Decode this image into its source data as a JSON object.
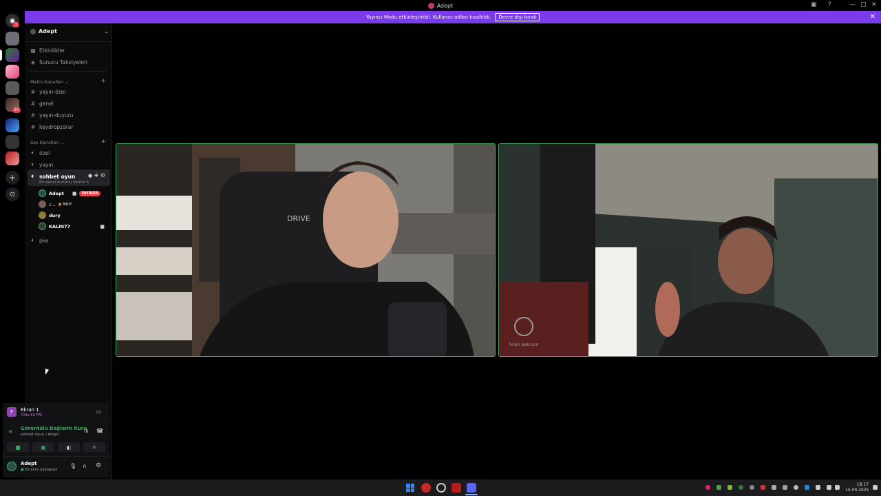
{
  "window": {
    "title": "Adept"
  },
  "banner": {
    "text": "Yayıncı Modu etkinleştirildi. Kullanıcı adları kısaltıldı.",
    "button": "Devre dışı bırak"
  },
  "sidebar": {
    "server_name": "Adept",
    "nav": [
      {
        "label": "Etkinlikler",
        "icon": "calendar-icon"
      },
      {
        "label": "Sunucu Takviyeleri",
        "icon": "boost-icon"
      }
    ],
    "text_category": "Metin Kanalları",
    "text_channels": [
      "yayın-özel",
      "genel",
      "yayın-duyuru",
      "keydropzarar"
    ],
    "voice_category": "Ses Kanalları",
    "voice_channels_top": [
      "özel",
      "yayın"
    ],
    "active_channel": {
      "name": "sohbet oyun",
      "topic": "Bir kanal durumu belirle"
    },
    "voice_users": [
      {
        "name": "Adept",
        "badge": "YAYINDA"
      },
      {
        "name": "c...",
        "badge": "İNCE"
      },
      {
        "name": "dury",
        "badge": ""
      },
      {
        "name": "KALIN77",
        "badge": ""
      }
    ],
    "voice_channels_bottom": [
      "pke"
    ]
  },
  "panel": {
    "screen_title": "Ekran 1",
    "screen_sub": "720p 60 FPS",
    "connection_title": "Görüntülü Bağlantı Kuru",
    "connection_sub": "sohbet oyun / Adept",
    "user_name": "Adept",
    "user_status": "Ekranını paylaşıyor"
  },
  "tiles": {
    "left_text": "DRIVE",
    "right_watermark": "brian webcam"
  },
  "taskbar": {
    "time": "18:17",
    "date": "15.09.2025"
  },
  "colors": {
    "banner": "#7c3aed",
    "speaking_border": "#3ba55d",
    "live_badge": "#ed4245"
  }
}
